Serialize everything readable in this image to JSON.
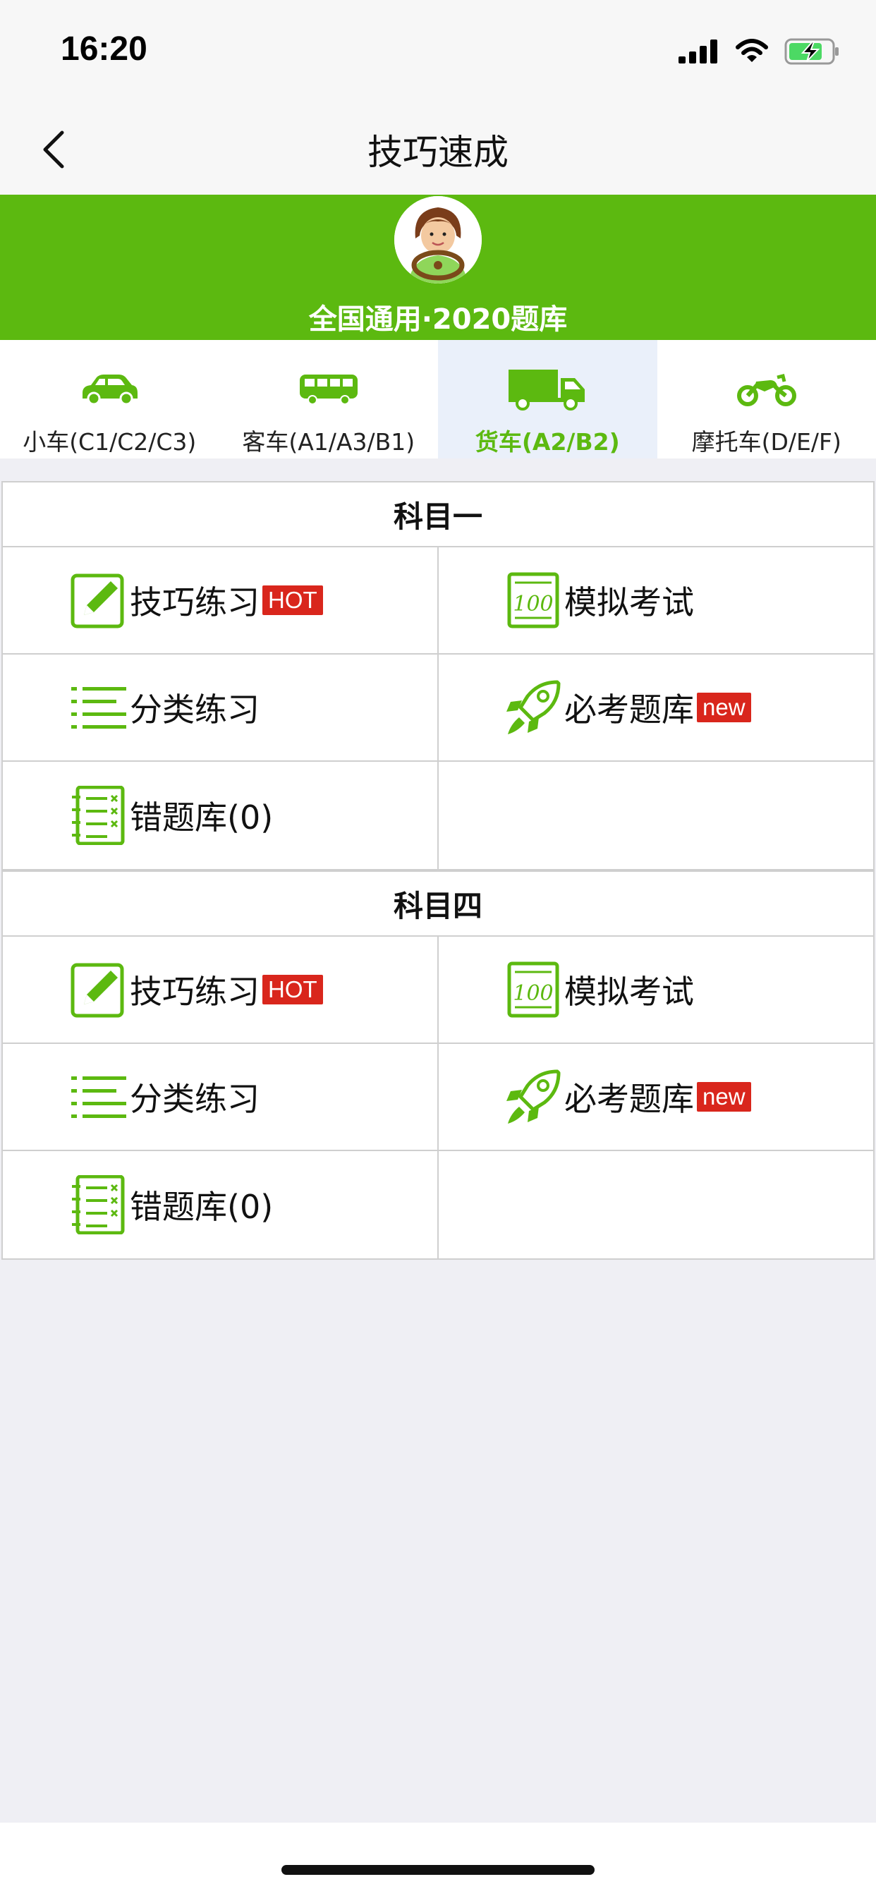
{
  "status_bar": {
    "time": "16:20"
  },
  "nav": {
    "title": "技巧速成"
  },
  "banner": {
    "text": "全国通用·2020题库"
  },
  "tabs": [
    {
      "label": "小车(C1/C2/C3)",
      "icon": "car-icon"
    },
    {
      "label": "客车(A1/A3/B1)",
      "icon": "bus-icon"
    },
    {
      "label": "货车(A2/B2)",
      "icon": "truck-icon",
      "active": true
    },
    {
      "label": "摩托车(D/E/F)",
      "icon": "motorcycle-icon"
    }
  ],
  "sections": [
    {
      "title": "科目一",
      "items": [
        {
          "label": "技巧练习",
          "badge": "HOT",
          "icon": "pencil-icon"
        },
        {
          "label": "模拟考试",
          "icon": "exam-paper-icon"
        },
        {
          "label": "分类练习",
          "icon": "list-icon"
        },
        {
          "label": "必考题库",
          "badge": "new",
          "icon": "rocket-icon"
        },
        {
          "label": "错题库(0)",
          "icon": "wrong-answers-icon"
        }
      ]
    },
    {
      "title": "科目四",
      "items": [
        {
          "label": "技巧练习",
          "badge": "HOT",
          "icon": "pencil-icon"
        },
        {
          "label": "模拟考试",
          "icon": "exam-paper-icon"
        },
        {
          "label": "分类练习",
          "icon": "list-icon"
        },
        {
          "label": "必考题库",
          "badge": "new",
          "icon": "rocket-icon"
        },
        {
          "label": "错题库(0)",
          "icon": "wrong-answers-icon"
        }
      ]
    }
  ],
  "colors": {
    "accent": "#5cb910",
    "badge": "#d9261c",
    "active_tab_bg": "#eaf0fa"
  }
}
